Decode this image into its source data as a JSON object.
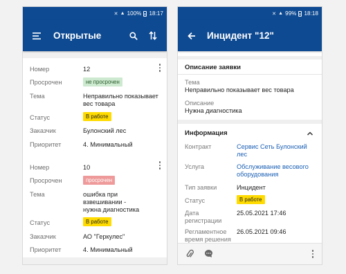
{
  "status_left": {
    "vol": "🔇",
    "signal": "▲",
    "battery": "100%",
    "time": "18:17"
  },
  "status_right": {
    "vol": "🔇",
    "signal": "▲",
    "battery": "99%",
    "time": "18:18"
  },
  "list_screen": {
    "title": "Открытые",
    "cards": [
      {
        "number_label": "Номер",
        "number": "12",
        "overdue_label": "Просрочен",
        "overdue": "не просрочен",
        "topic_label": "Тема",
        "topic": "Неправильно показывает вес товара",
        "status_label": "Статус",
        "status": "В работе",
        "customer_label": "Заказчик",
        "customer": "Булонский лес",
        "priority_label": "Приоритет",
        "priority": "4. Минимальный"
      },
      {
        "number_label": "Номер",
        "number": "10",
        "overdue_label": "Просрочен",
        "overdue": "просрочен",
        "topic_label": "Тема",
        "topic": "ошибка при взвешивании - нужна диагностика",
        "status_label": "Статус",
        "status": "В работе",
        "customer_label": "Заказчик",
        "customer": "АО \"Геркулес\"",
        "priority_label": "Приоритет",
        "priority": "4. Минимальный"
      }
    ]
  },
  "detail_screen": {
    "title": "Инцидент \"12\"",
    "description_section": "Описание заявки",
    "topic_label": "Тема",
    "topic": "Неправильно показывает вес товара",
    "description_label": "Описание",
    "description": "Нужна диагностика",
    "info_section": "Информация",
    "contract_label": "Контракт",
    "contract": "Сервис Сеть Булонский лес",
    "service_label": "Услуга",
    "service": "Обслуживание весового оборудования",
    "type_label": "Тип заявки",
    "type": "Инцидент",
    "status_label": "Статус",
    "status": "В работе",
    "reg_date_label": "Дата регистрации",
    "reg_date": "25.05.2021 17:46",
    "resolution_label": "Регламентное время решения",
    "resolution": "26.05.2021 09:46"
  },
  "colors": {
    "appbar": "#0e4a92",
    "link": "#1a5fb4",
    "badge_yellow": "#ffdb00",
    "badge_green": "#cde9cf",
    "badge_red": "#ef9a9a"
  },
  "icons": [
    "menu-icon",
    "search-icon",
    "sort-icon",
    "back-arrow-icon",
    "chevron-up-icon",
    "attach-icon",
    "comment-icon",
    "more-vert-icon"
  ]
}
